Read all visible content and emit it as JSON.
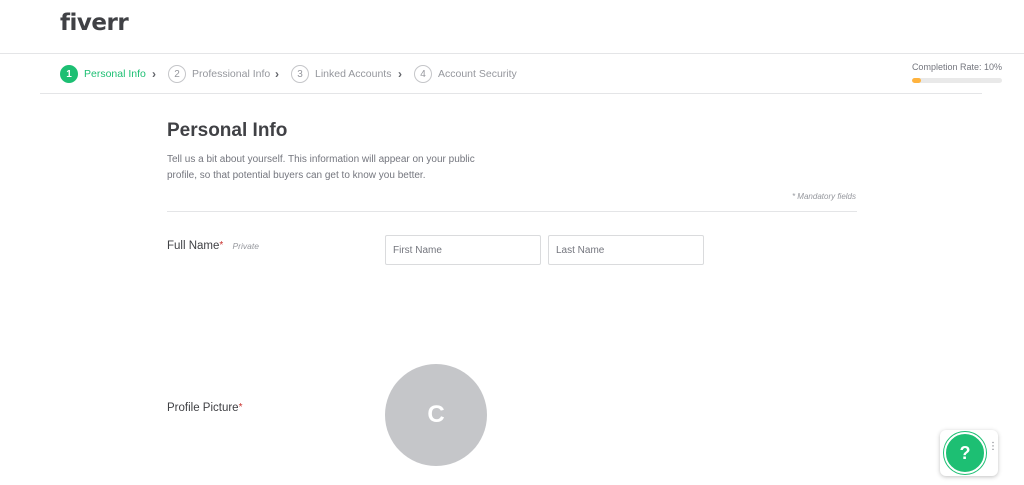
{
  "brand": {
    "logo_text": "fiverr"
  },
  "steps": [
    {
      "number": "1",
      "label": "Personal Info",
      "active": true
    },
    {
      "number": "2",
      "label": "Professional Info",
      "active": false
    },
    {
      "number": "3",
      "label": "Linked Accounts",
      "active": false
    },
    {
      "number": "4",
      "label": "Account Security",
      "active": false
    }
  ],
  "completion": {
    "label": "Completion Rate: 10%",
    "percent": 10
  },
  "main": {
    "title": "Personal Info",
    "intro": "Tell us a bit about yourself. This information will appear on your public profile, so that potential buyers can get to know you better.",
    "mandatory_note": "* Mandatory fields",
    "full_name": {
      "label": "Full Name",
      "required_mark": "*",
      "private_note": "Private",
      "first_placeholder": "First Name",
      "last_placeholder": "Last Name"
    },
    "profile_picture": {
      "label": "Profile Picture",
      "required_mark": "*",
      "avatar_initial": "C"
    }
  },
  "help": {
    "icon_text": "?",
    "more_icon": "⋮"
  },
  "colors": {
    "accent": "#1dbf73",
    "progress": "#ffb33e",
    "required": "#c9302c"
  }
}
